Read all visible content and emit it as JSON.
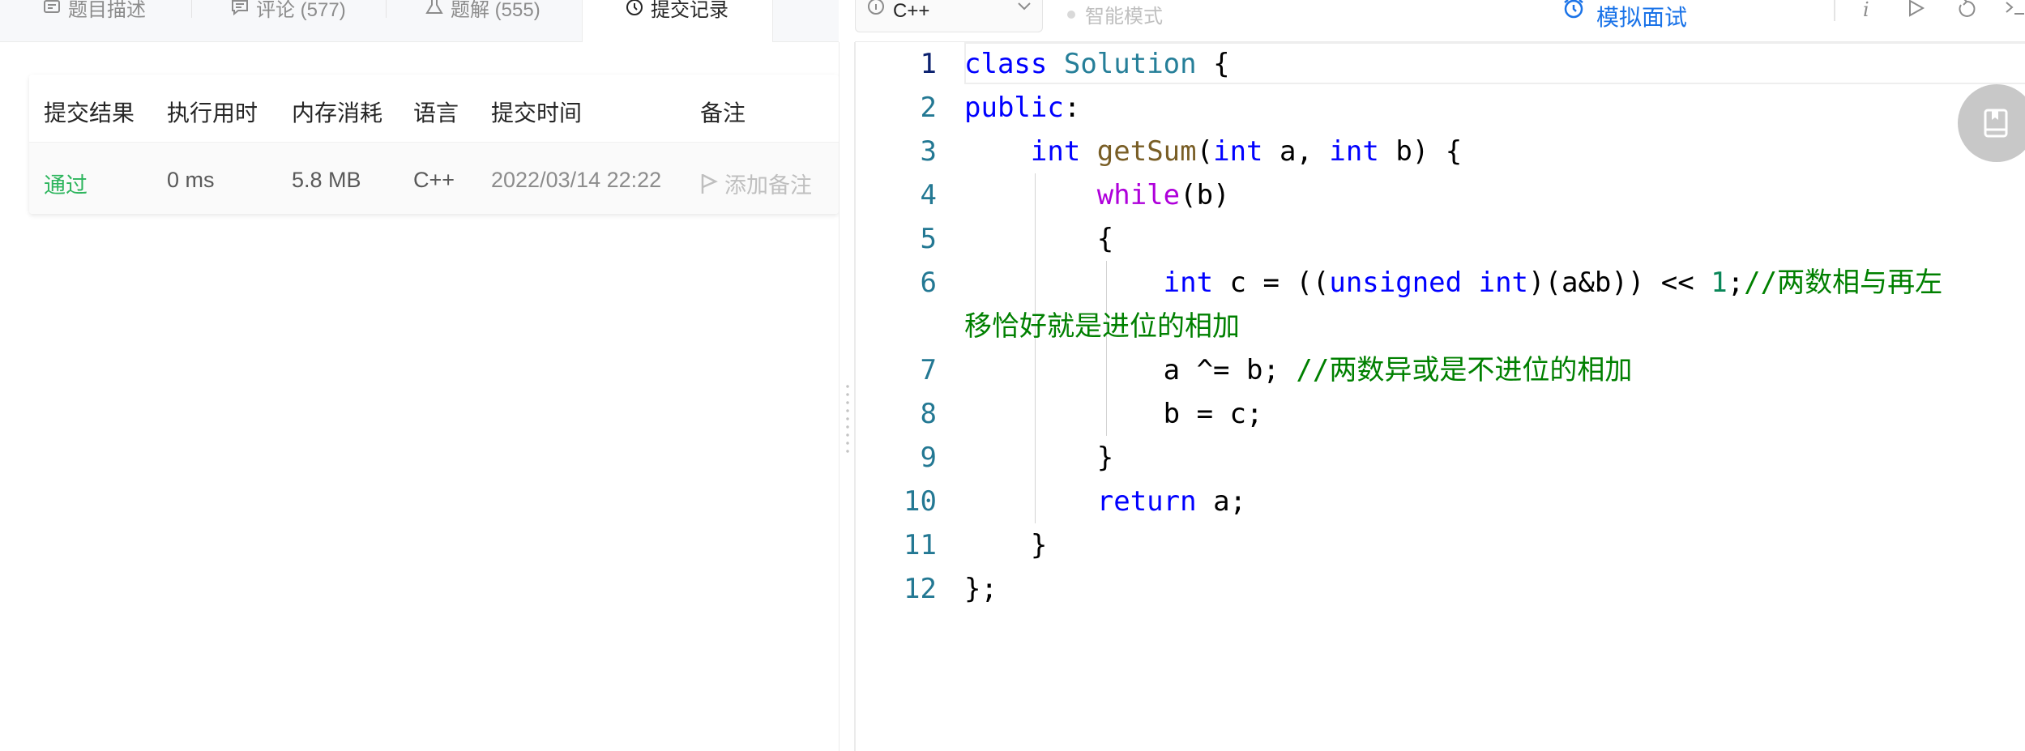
{
  "tabs": [
    {
      "label": "题目描述",
      "icon": "description-icon"
    },
    {
      "label": "评论 (577)",
      "icon": "comment-icon"
    },
    {
      "label": "题解 (555)",
      "icon": "flask-icon"
    },
    {
      "label": "提交记录",
      "icon": "clock-icon",
      "active": true
    }
  ],
  "submissions": {
    "headers": [
      "提交结果",
      "执行用时",
      "内存消耗",
      "语言",
      "提交时间",
      "备注"
    ],
    "rows": [
      {
        "result": "通过",
        "runtime": "0 ms",
        "memory": "5.8 MB",
        "language": "C++",
        "time": "2022/03/14 22:22",
        "note": "添加备注"
      }
    ]
  },
  "toolbar": {
    "language": "C++",
    "mode_label": "智能模式",
    "mock_interview": "模拟面试",
    "icons": [
      "info-icon",
      "run-icon",
      "reset-icon",
      "console-icon",
      "settings-icon",
      "fullscreen-icon"
    ]
  },
  "editor": {
    "line_numbers": [
      "1",
      "2",
      "3",
      "4",
      "5",
      "6",
      "7",
      "8",
      "9",
      "10",
      "11",
      "12"
    ],
    "lines": [
      "class Solution {",
      "public:",
      "    int getSum(int a, int b) {",
      "        while(b)",
      "        {",
      "            int c = ((unsigned int)(a&b)) << 1;//两数相与再左",
      "移恰好就是进位的相加",
      "            a ^= b; //两数异或是不进位的相加",
      "            b = c;",
      "        }",
      "        return a;",
      "    }",
      "};"
    ]
  },
  "colors": {
    "accent": "#1a73e8",
    "success": "#2db55d",
    "keyword": "#0000ff",
    "comment": "#008000",
    "line_number": "#237893"
  }
}
